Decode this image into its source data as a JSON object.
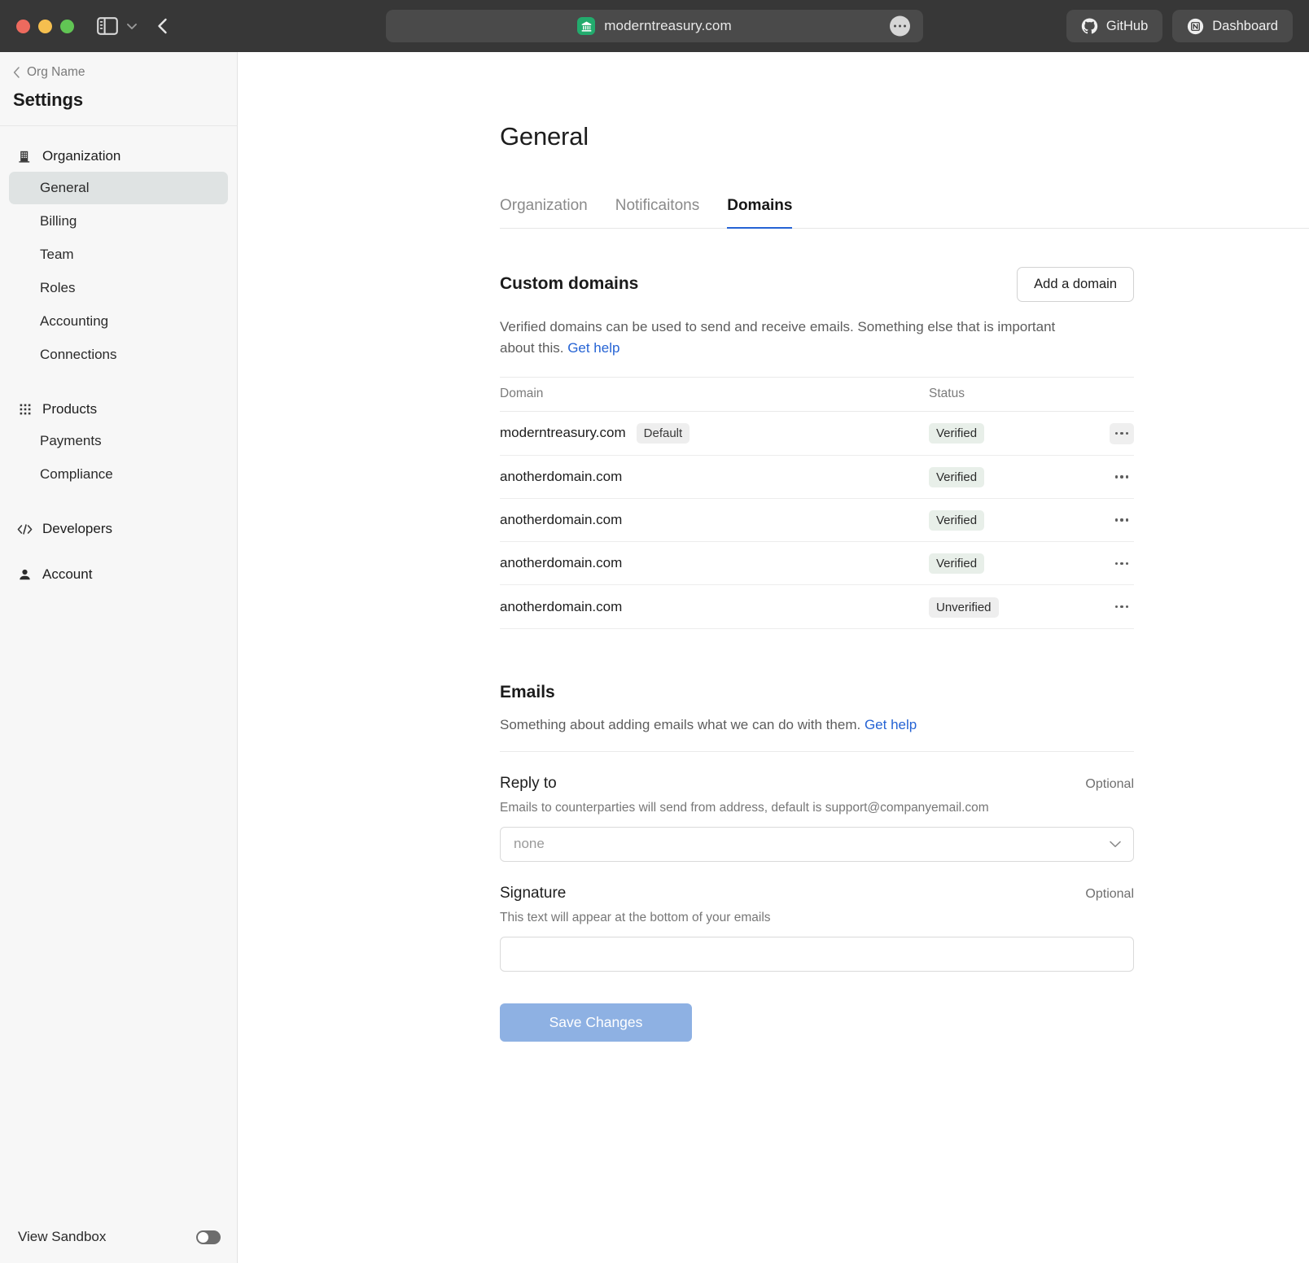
{
  "browser": {
    "url": "moderntreasury.com",
    "favicon_icon": "bank-favicon",
    "more_icon": "ellipsis-icon",
    "sidebar_toggle_icon": "sidebar-toggle-icon",
    "chevron_icon": "chevron-down-icon",
    "back_icon": "back-arrow-icon",
    "tabs": [
      {
        "label": "GitHub",
        "icon": "github-icon"
      },
      {
        "label": "Dashboard",
        "icon": "notion-icon"
      }
    ]
  },
  "sidebar": {
    "org_label": "Org Name",
    "back_icon": "chevron-left-icon",
    "title": "Settings",
    "groups": [
      {
        "header": "Organization",
        "icon": "building-icon",
        "items": [
          {
            "label": "General",
            "active": true
          },
          {
            "label": "Billing",
            "active": false
          },
          {
            "label": "Team",
            "active": false
          },
          {
            "label": "Roles",
            "active": false
          },
          {
            "label": "Accounting",
            "active": false
          },
          {
            "label": "Connections",
            "active": false
          }
        ]
      },
      {
        "header": "Products",
        "icon": "grid-icon",
        "items": [
          {
            "label": "Payments",
            "active": false
          },
          {
            "label": "Compliance",
            "active": false
          }
        ]
      },
      {
        "header": "Developers",
        "icon": "code-icon",
        "items": []
      },
      {
        "header": "Account",
        "icon": "person-icon",
        "items": []
      }
    ],
    "sandbox_label": "View Sandbox",
    "sandbox_enabled": false
  },
  "main": {
    "page_title": "General",
    "tabs": [
      {
        "label": "Organization",
        "active": false
      },
      {
        "label": "Notificaitons",
        "active": false
      },
      {
        "label": "Domains",
        "active": true
      }
    ],
    "custom_domains": {
      "title": "Custom domains",
      "add_button": "Add a domain",
      "description": "Verified domains can be used to send and receive emails. Something else that is important about this.",
      "help_link": "Get help",
      "columns": [
        "Domain",
        "Status",
        ""
      ],
      "rows": [
        {
          "domain": "moderntreasury.com",
          "chip": "Default",
          "status": "Verified",
          "menu_icon": "ellipsis-icon",
          "menu_hovered": true
        },
        {
          "domain": "anotherdomain.com",
          "chip": "",
          "status": "Verified",
          "menu_icon": "ellipsis-icon",
          "menu_hovered": false
        },
        {
          "domain": "anotherdomain.com",
          "chip": "",
          "status": "Verified",
          "menu_icon": "ellipsis-icon",
          "menu_hovered": false
        },
        {
          "domain": "anotherdomain.com",
          "chip": "",
          "status": "Verified",
          "menu_icon": "ellipsis-icon",
          "menu_hovered": false
        },
        {
          "domain": "anotherdomain.com",
          "chip": "",
          "status": "Unverified",
          "menu_icon": "ellipsis-icon",
          "menu_hovered": false
        }
      ]
    },
    "emails": {
      "title": "Emails",
      "description": "Something about adding emails what we can do with them.",
      "help_link": "Get help",
      "reply_to": {
        "label": "Reply to",
        "optional": "Optional",
        "help": "Emails to counterparties will send from address, default is support@companyemail.com",
        "value": "none",
        "chevron_icon": "chevron-down-icon"
      },
      "signature": {
        "label": "Signature",
        "optional": "Optional",
        "help": "This text will appear at the bottom of your emails",
        "value": ""
      },
      "save_button": "Save Changes"
    }
  },
  "colors": {
    "accent": "#2563d4",
    "primary_button": "#8eb1e3",
    "verified_chip": "#e8efe9",
    "chrome": "#373737",
    "favicon_green": "#22ab6d"
  }
}
